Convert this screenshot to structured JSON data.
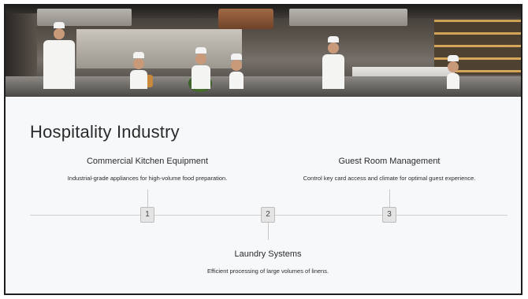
{
  "slide": {
    "title": "Hospitality Industry",
    "steps": [
      {
        "number": "1",
        "label": "Commercial Kitchen Equipment",
        "description": "Industrial-grade appliances for high-volume food preparation."
      },
      {
        "number": "2",
        "label": "Laundry Systems",
        "description": "Efficient processing of large volumes of linens."
      },
      {
        "number": "3",
        "label": "Guest Room Management",
        "description": "Control key card access and climate for optimal guest experience."
      }
    ]
  },
  "colors": {
    "background": "#f7f8fa",
    "border": "#1e1e1e",
    "timeline": "#cfcfcf",
    "marker_fill": "#e4e4e4"
  }
}
